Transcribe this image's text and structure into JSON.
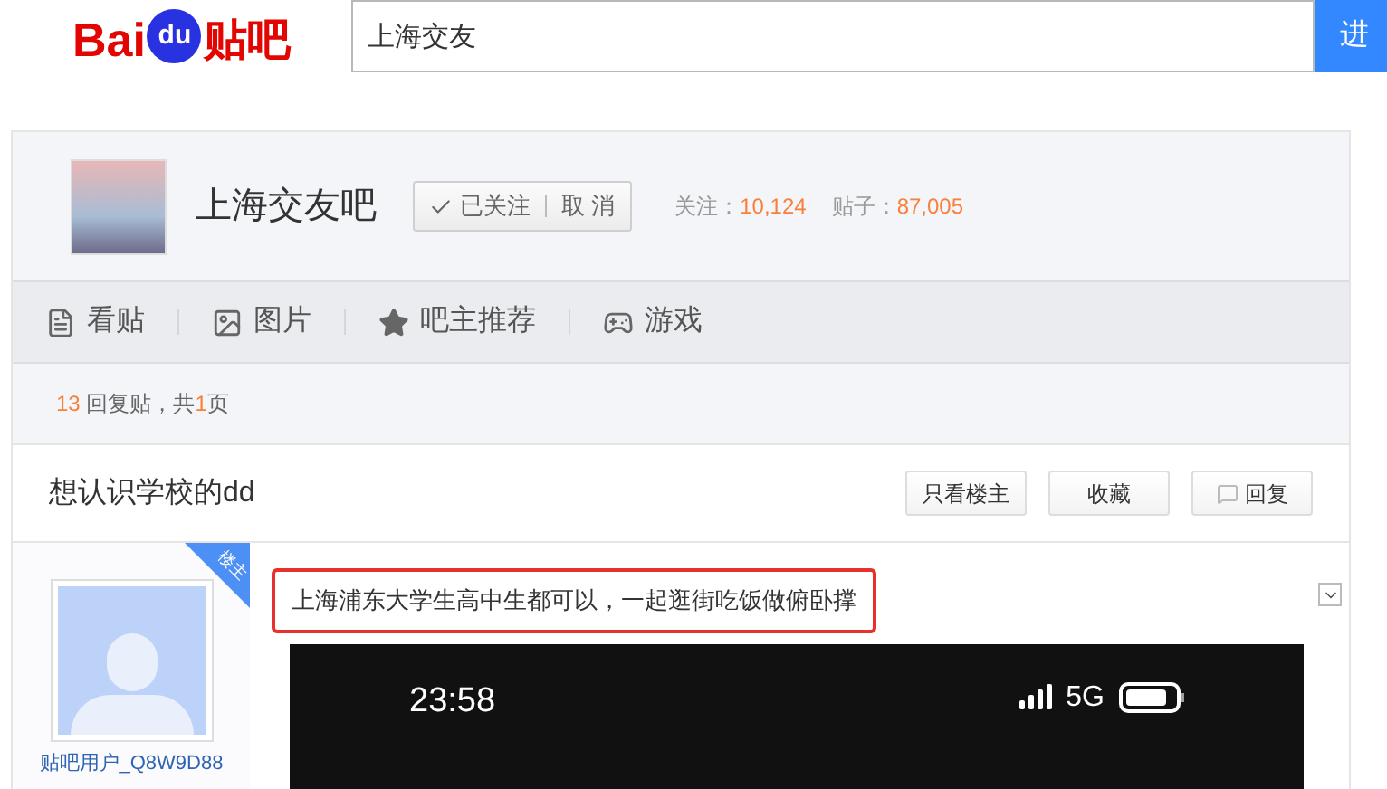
{
  "header": {
    "logo_left": "Bai",
    "logo_mid": "du",
    "logo_right": "贴吧",
    "search_value": "上海交友",
    "search_button": "进"
  },
  "forum": {
    "name": "上海交友吧",
    "follow_label": "已关注",
    "unfollow_label": "取 消",
    "followers_label": "关注：",
    "followers": "10,124",
    "posts_label": "贴子：",
    "posts": "87,005"
  },
  "nav": [
    {
      "label": "看贴"
    },
    {
      "label": "图片"
    },
    {
      "label": "吧主推荐"
    },
    {
      "label": "游戏"
    }
  ],
  "reply_info": {
    "count": "13",
    "text1": "回复贴，共",
    "pages": "1",
    "text2": "页"
  },
  "thread": {
    "title": "想认识学校的dd",
    "buttons": [
      {
        "label": "只看楼主",
        "kind": "plain"
      },
      {
        "label": "收藏",
        "kind": "plain"
      },
      {
        "label": "回复",
        "kind": "reply"
      }
    ]
  },
  "post": {
    "badge": "楼主",
    "username": "贴吧用户_Q8W9D88",
    "content": "上海浦东大学生高中生都可以，一起逛街吃饭做俯卧撑",
    "image": {
      "time": "23:58",
      "network": "5G"
    }
  }
}
